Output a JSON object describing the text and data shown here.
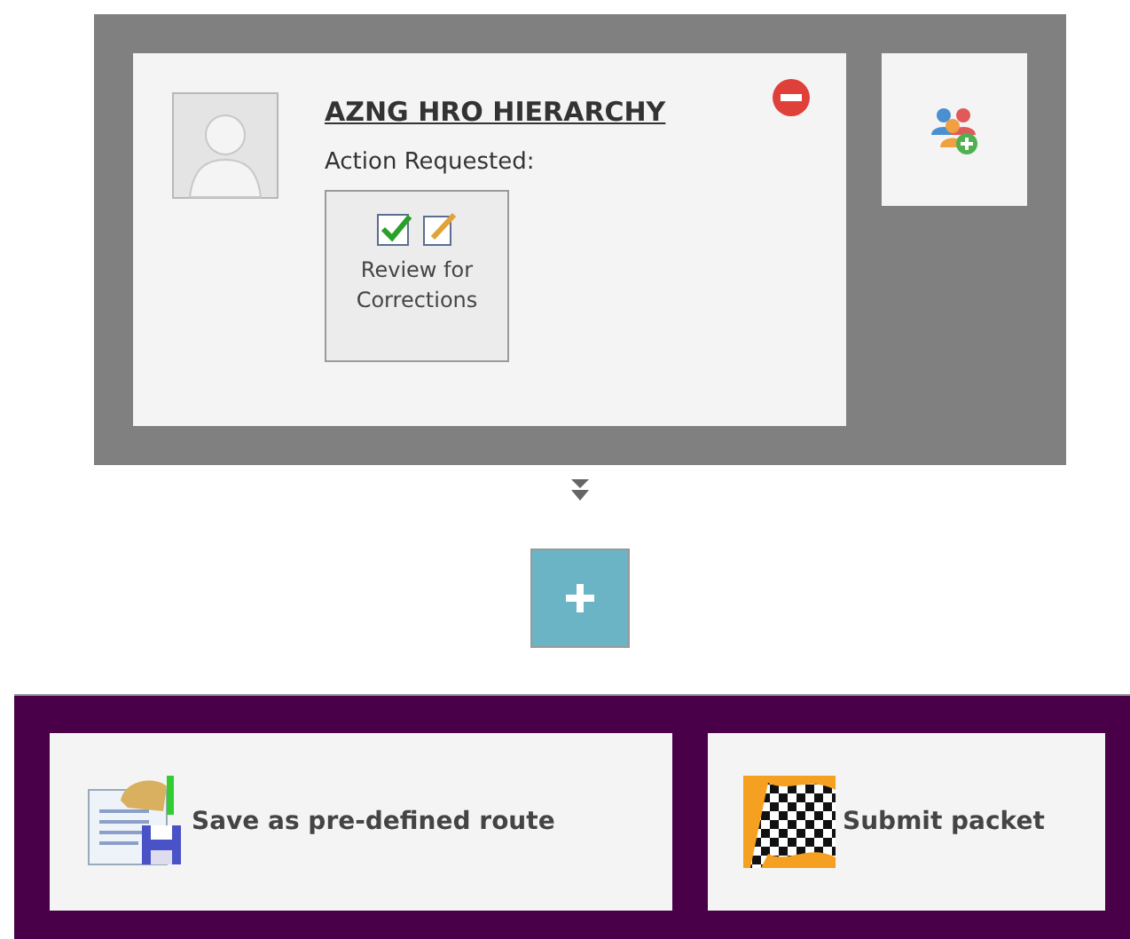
{
  "step": {
    "approver": {
      "name": "AZNG HRO HIERARCHY",
      "action_label": "Action Requested:",
      "action": "Review for Corrections"
    }
  },
  "actions": [
    {
      "kind": "save",
      "label": "Save as pre-defined route"
    },
    {
      "kind": "submit",
      "label": "Submit packet"
    }
  ]
}
